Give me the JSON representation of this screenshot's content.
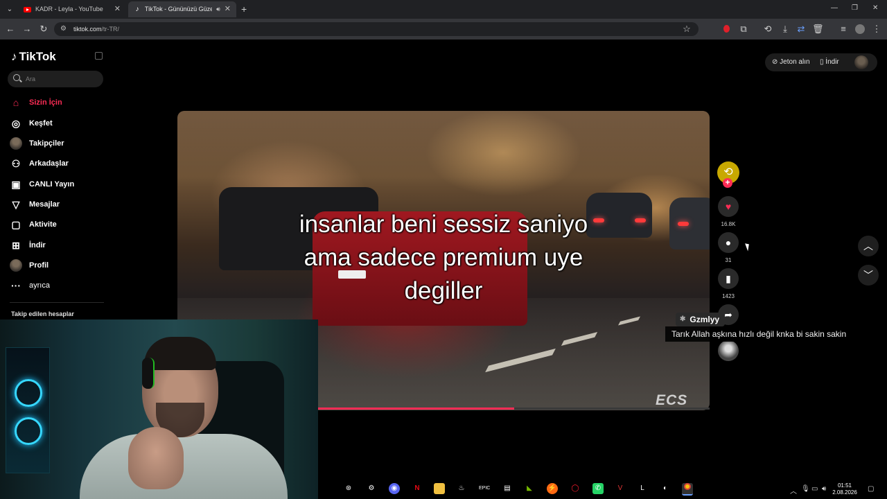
{
  "browser": {
    "tabs": [
      {
        "title": "KADR - Leyla - YouTube",
        "icon": "youtube-icon"
      },
      {
        "title": "TikTok - Gününüzü Güzelleş",
        "icon": "tiktok-icon"
      }
    ],
    "new_tab": "+",
    "url_main": "tiktok.com",
    "url_path": "/tr-TR/"
  },
  "tiktok": {
    "logo": "TikTok",
    "search_placeholder": "Ara",
    "nav": [
      {
        "label": "Sizin İçin",
        "icon": "home-icon",
        "active": true
      },
      {
        "label": "Keşfet",
        "icon": "compass-icon"
      },
      {
        "label": "Takipçiler",
        "icon": "avatar-icon"
      },
      {
        "label": "Arkadaşlar",
        "icon": "friends-icon"
      },
      {
        "label": "CANLI Yayın",
        "icon": "live-tv-icon"
      },
      {
        "label": "Mesajlar",
        "icon": "send-icon"
      },
      {
        "label": "Aktivite",
        "icon": "message-box-icon"
      },
      {
        "label": "İndir",
        "icon": "download-icon"
      },
      {
        "label": "Profil",
        "icon": "profile-avatar-icon"
      },
      {
        "label": "ayrıca",
        "icon": "more-icon"
      }
    ],
    "following_header": "Takip edilen hesaplar",
    "top_right": {
      "coins": "Jeton alın",
      "download": "İndir"
    },
    "video": {
      "caption": [
        "insanlar beni sessiz saniyo",
        "ama sadece premium uye",
        "degiller"
      ],
      "watermark": "ECS",
      "progress": 0.5
    },
    "actions": {
      "likes": "16.8K",
      "comments": "31",
      "saves": "1423"
    }
  },
  "chat": {
    "user": "Gzmlyy",
    "message": "Tarık Allah aşkına hızlı değil knka bi sakin sakin"
  },
  "taskbar": {
    "time": "01:51",
    "date": "2.08.2026"
  },
  "colors": {
    "accent": "#fe2c55",
    "background": "#000000",
    "chrome": "#35363a"
  }
}
